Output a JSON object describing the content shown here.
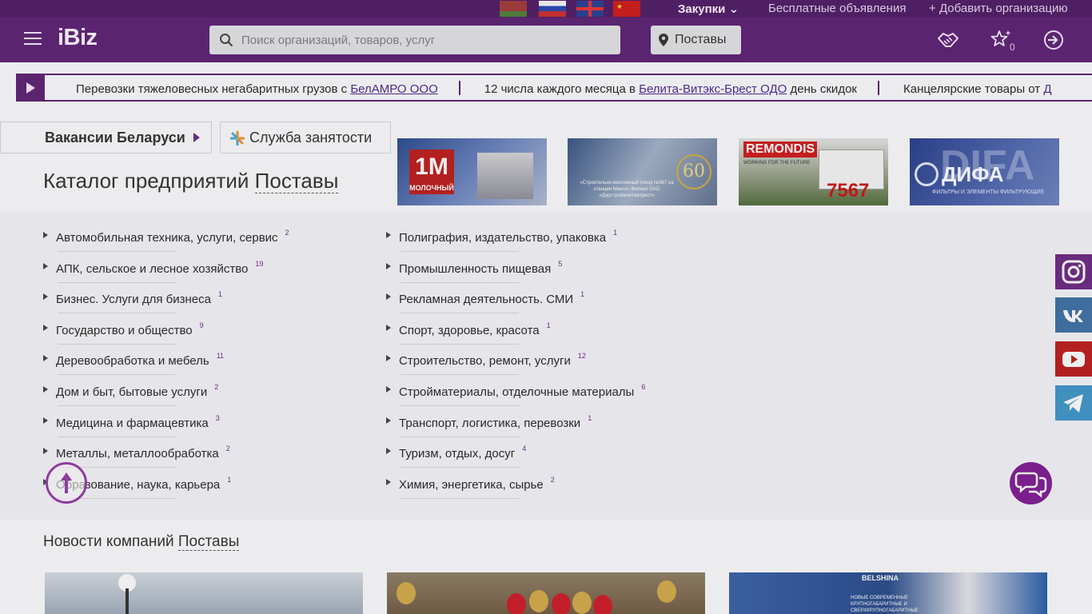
{
  "topbar": {
    "flags": [
      "by-flag",
      "ru-flag",
      "gb-flag",
      "cn-flag"
    ],
    "purchases_label": "Закупки",
    "free_ads_label": "Бесплатные объявления",
    "add_org_label": "Добавить организацию"
  },
  "header": {
    "logo": "iBiz",
    "search_placeholder": "Поиск организаций, товаров, услуг",
    "location_label": "Поставы",
    "favorites_count": "0"
  },
  "ticker": {
    "items": [
      {
        "text": "Перевозки тяжеловесных негабаритных грузов с ",
        "link": "БелАМРО ООО",
        "after": ""
      },
      {
        "text": "12 числа каждого месяца в ",
        "link": "Белита-Витэкс-Брест ОДО",
        "after": " день скидок"
      },
      {
        "text": "Канцелярские товары от ",
        "link": "Д",
        "after": ""
      }
    ]
  },
  "buttons": {
    "vacancies": "Вакансии Беларуси",
    "employment": "Служба занятости"
  },
  "catalog": {
    "title": "Каталог предприятий",
    "city": "Поставы"
  },
  "banners": {
    "b1_logo": "1M",
    "b1_sub": "МОЛОЧНЫЙ",
    "b2_text": "«Строительно-монтажный поезд №367 на станции Минск» Филиал ОАО «Дорстроймонтажтрест»",
    "b2_years": "60",
    "b3_brand": "REMONDIS",
    "b3_sub": "WORKING FOR THE FUTURE",
    "b3_number": "7567",
    "b4_bg": "DIFA",
    "b4_name": "ДИФА",
    "b4_sub": "ФИЛЬТРЫ И ЭЛЕМЕНТЫ ФИЛЬТРУЮЩИЕ"
  },
  "categories": {
    "left": [
      {
        "label": "Автомобильная техника, услуги, сервис",
        "count": "2"
      },
      {
        "label": "АПК, сельское и лесное хозяйство",
        "count": "19"
      },
      {
        "label": "Бизнес. Услуги для бизнеса",
        "count": "1"
      },
      {
        "label": "Государство и общество",
        "count": "9"
      },
      {
        "label": "Деревообработка и мебель",
        "count": "11"
      },
      {
        "label": "Дом и быт, бытовые услуги",
        "count": "2"
      },
      {
        "label": "Медицина и фармацевтика",
        "count": "3"
      },
      {
        "label": "Металлы, металлообработка",
        "count": "2"
      },
      {
        "label": "Образование, наука, карьера",
        "count": "1"
      }
    ],
    "right": [
      {
        "label": "Полиграфия, издательство, упаковка",
        "count": "1"
      },
      {
        "label": "Промышленность пищевая",
        "count": "5"
      },
      {
        "label": "Рекламная деятельность. СМИ",
        "count": "1"
      },
      {
        "label": "Спорт, здоровье, красота",
        "count": "1"
      },
      {
        "label": "Строительство, ремонт, услуги",
        "count": "12"
      },
      {
        "label": "Стройматериалы, отделочные материалы",
        "count": "6"
      },
      {
        "label": "Транспорт, логистика, перевозки",
        "count": "1"
      },
      {
        "label": "Туризм, отдых, досуг",
        "count": "4"
      },
      {
        "label": "Химия, энергетика, сырье",
        "count": "2"
      }
    ]
  },
  "social": [
    "instagram-icon",
    "vk-icon",
    "youtube-icon",
    "telegram-icon"
  ],
  "news": {
    "title": "Новости компаний",
    "city": "Поставы",
    "n3_brand": "BELSHINA",
    "n3_text": "НОВЫЕ СОВРЕМЕННЫЕ КРУПНОГАБАРИТНЫЕ И СВЕРХКРУПНОГАБАРИТНЫЕ"
  },
  "colors": {
    "brand": "#5b2470",
    "accent": "#7b1f8f"
  }
}
